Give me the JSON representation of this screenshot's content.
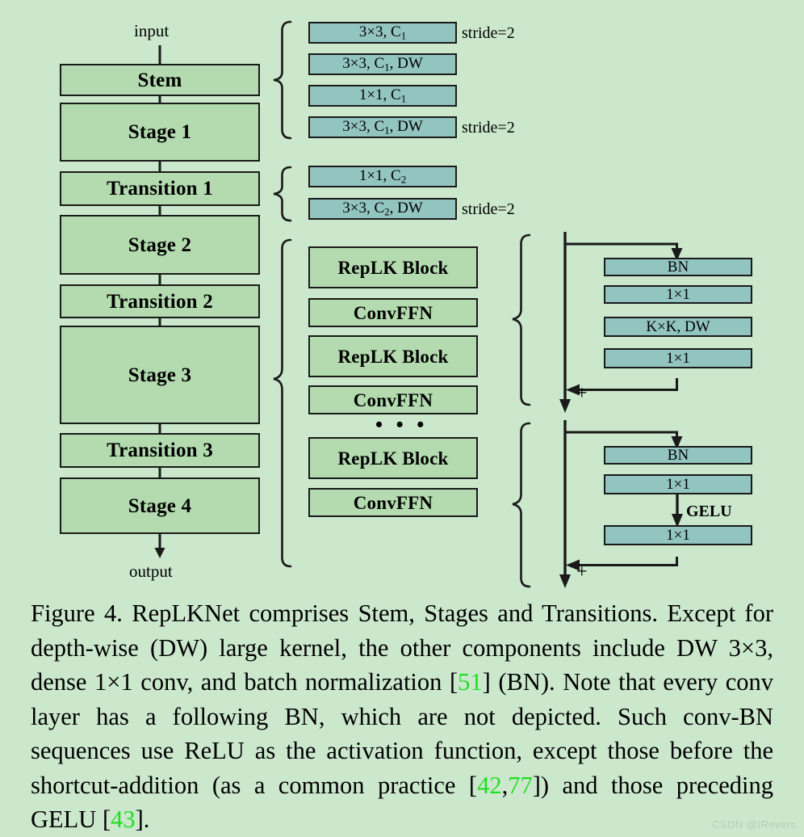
{
  "figure": {
    "io": {
      "input": "input",
      "output": "output"
    },
    "backbone": [
      {
        "label": "Stem"
      },
      {
        "label": "Stage 1"
      },
      {
        "label": "Transition 1"
      },
      {
        "label": "Stage 2"
      },
      {
        "label": "Transition 2"
      },
      {
        "label": "Stage 3"
      },
      {
        "label": "Transition 3"
      },
      {
        "label": "Stage 4"
      }
    ],
    "stem_detail": {
      "layers": [
        {
          "label": "3×3, C",
          "sub": "1",
          "note": "stride=2"
        },
        {
          "label": "3×3, C",
          "sub": "1",
          "suffix": ", DW",
          "note": ""
        },
        {
          "label": "1×1, C",
          "sub": "1",
          "note": ""
        },
        {
          "label": "3×3, C",
          "sub": "1",
          "suffix": ", DW",
          "note": "stride=2"
        }
      ]
    },
    "transition_detail": {
      "layers": [
        {
          "label": "1×1, C",
          "sub": "2",
          "note": ""
        },
        {
          "label": "3×3, C",
          "sub": "2",
          "suffix": ", DW",
          "note": "stride=2"
        }
      ]
    },
    "stage_detail": {
      "blocks": [
        {
          "label": "RepLK Block",
          "kind": "replk"
        },
        {
          "label": "ConvFFN",
          "kind": "convffn"
        },
        {
          "label": "RepLK Block",
          "kind": "replk"
        },
        {
          "label": "ConvFFN",
          "kind": "convffn"
        }
      ],
      "ellipsis": "• • •",
      "tail_blocks": [
        {
          "label": "RepLK Block",
          "kind": "replk"
        },
        {
          "label": "ConvFFN",
          "kind": "convffn"
        }
      ]
    },
    "replk_detail": {
      "layers": [
        "BN",
        "1×1",
        "K×K, DW",
        "1×1"
      ],
      "add_symbol": "+"
    },
    "convffn_detail": {
      "layers": [
        "BN",
        "1×1",
        "1×1"
      ],
      "activation": "GELU",
      "add_symbol": "+"
    }
  },
  "caption": {
    "text_1": "Figure 4. RepLKNet comprises Stem, Stages and Transitions. Except for depth-wise (DW) large kernel, the other components include DW 3×3, dense 1×1 conv, and batch normalization [",
    "ref_1": "51",
    "text_2": "] (BN). Note that every conv layer has a following BN, which are not depicted. Such conv-BN sequences use ReLU as the activation function, except those before the shortcut-addition (as a common practice [",
    "ref_2": "42",
    "sep_1": ",",
    "ref_3": "77",
    "text_3": "]) and those preceding GELU [",
    "ref_4": "43",
    "text_4": "]."
  },
  "watermark": {
    "label": "CSDN @IRevers"
  },
  "colors": {
    "page_background": "#cbe8cd",
    "green_box": "#b3dbaf",
    "blue_box": "#92c4c0",
    "stroke": "#1a1a1a",
    "reference_link": "#22dd22"
  }
}
